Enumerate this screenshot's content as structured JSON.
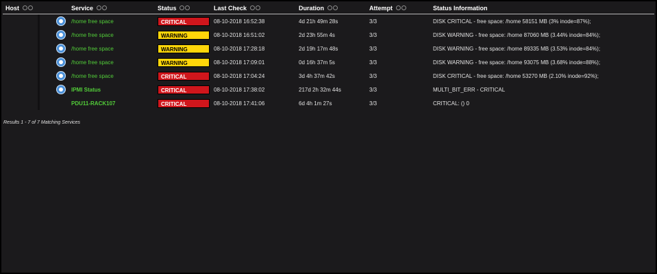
{
  "table": {
    "headers": {
      "host": "Host",
      "service": "Service",
      "status": "Status",
      "last_check": "Last Check",
      "duration": "Duration",
      "attempt": "Attempt",
      "status_info": "Status Information"
    },
    "rows": [
      {
        "service": "/home free space",
        "service_bold": false,
        "has_icon": true,
        "icon": "service-status-icon",
        "status": "CRITICAL",
        "status_class": "critical",
        "last_check": "08-10-2018 16:52:38",
        "duration": "4d 21h 49m 28s",
        "attempt": "3/3",
        "status_info": "DISK CRITICAL - free space: /home 58151 MB (3% inode=87%);"
      },
      {
        "service": "/home free space",
        "service_bold": false,
        "has_icon": true,
        "icon": "service-status-icon",
        "status": "WARNING",
        "status_class": "warning",
        "last_check": "08-10-2018 16:51:02",
        "duration": "2d 23h 55m 4s",
        "attempt": "3/3",
        "status_info": "DISK WARNING - free space: /home 87060 MB (3.44% inode=84%);"
      },
      {
        "service": "/home free space",
        "service_bold": false,
        "has_icon": true,
        "icon": "service-status-icon",
        "status": "WARNING",
        "status_class": "warning",
        "last_check": "08-10-2018 17:28:18",
        "duration": "2d 19h 17m 48s",
        "attempt": "3/3",
        "status_info": "DISK WARNING - free space: /home 89335 MB (3.53% inode=84%);"
      },
      {
        "service": "/home free space",
        "service_bold": false,
        "has_icon": true,
        "icon": "service-status-icon",
        "status": "WARNING",
        "status_class": "warning",
        "last_check": "08-10-2018 17:09:01",
        "duration": "0d 16h 37m 5s",
        "attempt": "3/3",
        "status_info": "DISK WARNING - free space: /home 93075 MB (3.68% inode=88%);"
      },
      {
        "service": "/home free space",
        "service_bold": false,
        "has_icon": true,
        "icon": "service-status-icon",
        "status": "CRITICAL",
        "status_class": "critical",
        "last_check": "08-10-2018 17:04:24",
        "duration": "3d 4h 37m 42s",
        "attempt": "3/3",
        "status_info": "DISK CRITICAL - free space: /home 53270 MB (2.10% inode=92%);"
      },
      {
        "service": "IPMI Status",
        "service_bold": true,
        "has_icon": true,
        "icon": "service-status-icon",
        "status": "CRITICAL",
        "status_class": "critical",
        "last_check": "08-10-2018 17:38:02",
        "duration": "217d 2h 32m 44s",
        "attempt": "3/3",
        "status_info": "MULTI_BIT_ERR - CRITICAL"
      },
      {
        "service": "PDU11-RACK107",
        "service_bold": true,
        "has_icon": false,
        "icon": "",
        "status": "CRITICAL",
        "status_class": "critical",
        "last_check": "08-10-2018 17:41:06",
        "duration": "6d 4h 1m 27s",
        "attempt": "3/3",
        "status_info": "CRITICAL: () 0"
      }
    ]
  },
  "results_text": "Results 1 - 7 of 7 Matching Services",
  "colors": {
    "background": "#1b1a1c",
    "service_link": "#52cc39",
    "critical": "#d0161c",
    "warning": "#ffd60a",
    "text": "#e2e2e2"
  }
}
